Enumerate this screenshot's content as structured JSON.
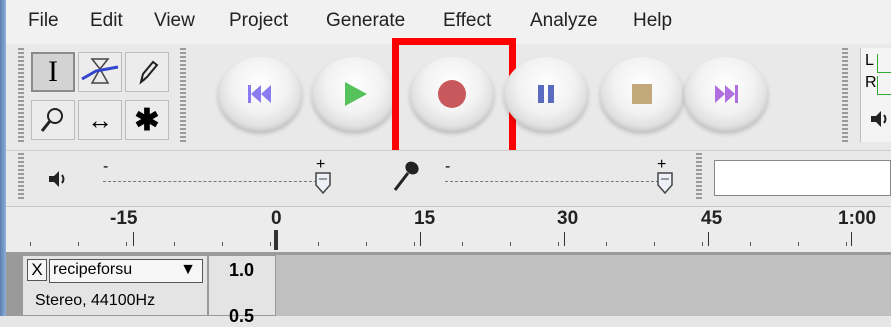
{
  "menu": [
    "File",
    "Edit",
    "View",
    "Project",
    "Generate",
    "Effect",
    "Analyze",
    "Help"
  ],
  "tools": {
    "selection_symbol": "I",
    "multi_symbol": "✱",
    "timeshift_symbol": "↔"
  },
  "transport": {
    "skip_start_icon": "skip-to-start-icon",
    "play_icon": "play-icon",
    "record_icon": "record-icon",
    "pause_icon": "pause-icon",
    "stop_icon": "stop-icon",
    "skip_end_icon": "skip-to-end-icon",
    "highlight_color": "#ff0000"
  },
  "meter": {
    "left_label": "L",
    "right_label": "R"
  },
  "mixer": {
    "output_minus": "-",
    "output_plus": "+",
    "input_minus": "-",
    "input_plus": "+"
  },
  "ruler": {
    "labels": [
      "-15",
      "0",
      "15",
      "30",
      "45",
      "1:00"
    ]
  },
  "track": {
    "close_label": "X",
    "name": "recipeforsu",
    "menu_arrow": "▼",
    "format": "Stereo, 44100Hz",
    "scale_top": "1.0",
    "scale_next": "0.5"
  }
}
